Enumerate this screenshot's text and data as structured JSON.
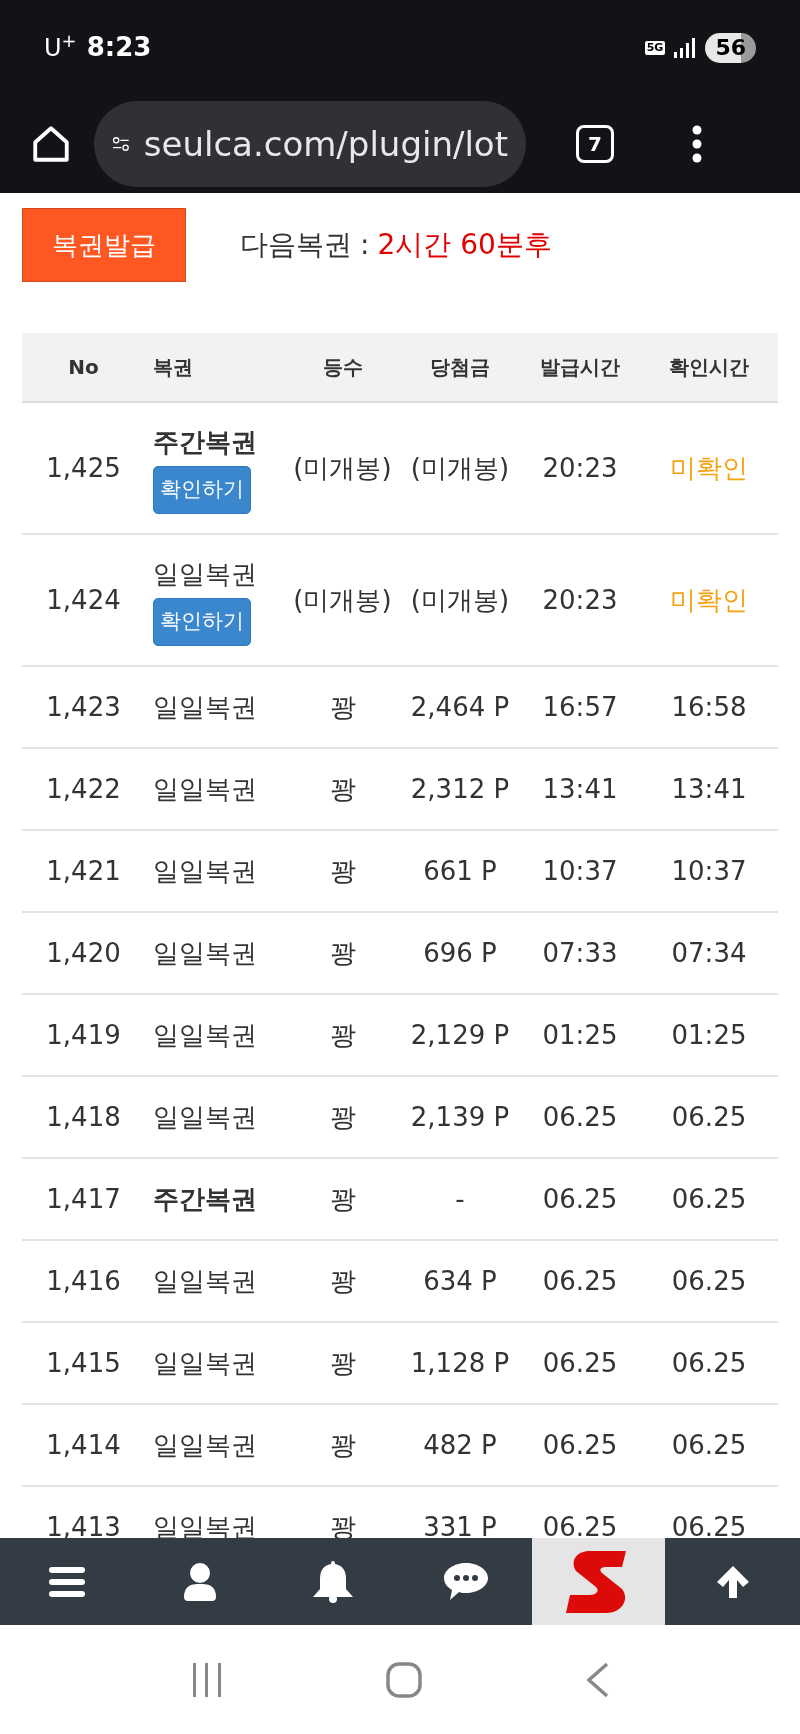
{
  "status_bar": {
    "carrier": "U$^{+}$",
    "time": "8:23",
    "network": "5G",
    "battery": "56"
  },
  "browser": {
    "url": "seulca.com/plugin/lot",
    "tab_count": "7"
  },
  "issue_button": "복권발급",
  "next_ticket": {
    "label": "다음복권",
    "separator": ":",
    "value": "2시간 60분후"
  },
  "table": {
    "columns": [
      "No",
      "복권",
      "등수",
      "당첨금",
      "발급시간",
      "확인시간"
    ],
    "rows": [
      {
        "no": "1,425",
        "ticket": "주간복권",
        "kind": "weekly",
        "button": "확인하기",
        "rank": "(미개봉)",
        "prize": "(미개봉)",
        "issued": "20:23",
        "checked_time": "미확인",
        "checked": false
      },
      {
        "no": "1,424",
        "ticket": "일일복권",
        "kind": "daily",
        "button": "확인하기",
        "rank": "(미개봉)",
        "prize": "(미개봉)",
        "issued": "20:23",
        "checked_time": "미확인",
        "checked": false
      },
      {
        "no": "1,423",
        "ticket": "일일복권",
        "kind": "daily",
        "rank": "꽝",
        "prize": "2,464 P",
        "issued": "16:57",
        "checked_time": "16:58",
        "checked": true
      },
      {
        "no": "1,422",
        "ticket": "일일복권",
        "kind": "daily",
        "rank": "꽝",
        "prize": "2,312 P",
        "issued": "13:41",
        "checked_time": "13:41",
        "checked": true
      },
      {
        "no": "1,421",
        "ticket": "일일복권",
        "kind": "daily",
        "rank": "꽝",
        "prize": "661 P",
        "issued": "10:37",
        "checked_time": "10:37",
        "checked": true
      },
      {
        "no": "1,420",
        "ticket": "일일복권",
        "kind": "daily",
        "rank": "꽝",
        "prize": "696 P",
        "issued": "07:33",
        "checked_time": "07:34",
        "checked": true
      },
      {
        "no": "1,419",
        "ticket": "일일복권",
        "kind": "daily",
        "rank": "꽝",
        "prize": "2,129 P",
        "issued": "01:25",
        "checked_time": "01:25",
        "checked": true
      },
      {
        "no": "1,418",
        "ticket": "일일복권",
        "kind": "daily",
        "rank": "꽝",
        "prize": "2,139 P",
        "issued": "06.25",
        "checked_time": "06.25",
        "checked": true
      },
      {
        "no": "1,417",
        "ticket": "주간복권",
        "kind": "weekly",
        "rank": "꽝",
        "prize": "-",
        "issued": "06.25",
        "checked_time": "06.25",
        "checked": true
      },
      {
        "no": "1,416",
        "ticket": "일일복권",
        "kind": "daily",
        "rank": "꽝",
        "prize": "634 P",
        "issued": "06.25",
        "checked_time": "06.25",
        "checked": true
      },
      {
        "no": "1,415",
        "ticket": "일일복권",
        "kind": "daily",
        "rank": "꽝",
        "prize": "1,128 P",
        "issued": "06.25",
        "checked_time": "06.25",
        "checked": true
      },
      {
        "no": "1,414",
        "ticket": "일일복권",
        "kind": "daily",
        "rank": "꽝",
        "prize": "482 P",
        "issued": "06.25",
        "checked_time": "06.25",
        "checked": true
      },
      {
        "no": "1,413",
        "ticket": "일일복권",
        "kind": "daily",
        "rank": "꽝",
        "prize": "331 P",
        "issued": "06.25",
        "checked_time": "06.25",
        "checked": true
      }
    ]
  }
}
